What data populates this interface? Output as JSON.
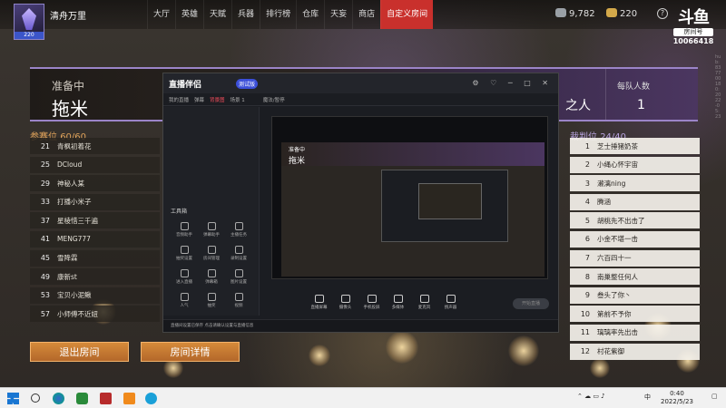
{
  "player": {
    "name": "清舟万里",
    "level": "220"
  },
  "nav": [
    "大厅",
    "英雄",
    "天赋",
    "兵器",
    "排行榜",
    "仓库",
    "天妄",
    "商店",
    "自定义房间"
  ],
  "nav_active_index": 8,
  "currency": {
    "gold_coins": "9,782",
    "gold_bars": "220",
    "coin_color": "#9aa0a6",
    "bar_color": "#d4a94a"
  },
  "watermark": {
    "brand": "斗鱼",
    "room_label": "房间号",
    "room_number": "10066418",
    "side_text": "hub:83770018 0:2022-05:23"
  },
  "room": {
    "status": "准备中",
    "name": "拖米",
    "mode_partial": "之人",
    "team_size_label": "每队人数",
    "team_size": "1"
  },
  "participants": {
    "title": "参赛位",
    "count": "60/60",
    "items": [
      {
        "num": "21",
        "name": "青枫初着花"
      },
      {
        "num": "25",
        "name": "DCloud"
      },
      {
        "num": "29",
        "name": "神秘人某"
      },
      {
        "num": "33",
        "name": "打播小米子"
      },
      {
        "num": "37",
        "name": "星棱惜三千遍"
      },
      {
        "num": "41",
        "name": "MENG777"
      },
      {
        "num": "45",
        "name": "雪降霖"
      },
      {
        "num": "49",
        "name": "康新st"
      },
      {
        "num": "53",
        "name": "宝贝小泥鳅"
      },
      {
        "num": "57",
        "name": "小师傅不近妞"
      }
    ]
  },
  "referees": {
    "title": "裁判位",
    "count": "24/40",
    "items": [
      {
        "num": "1",
        "name": "芝士捶猪奶茶"
      },
      {
        "num": "2",
        "name": "小绳心怀宇宙"
      },
      {
        "num": "3",
        "name": "濑漓ning"
      },
      {
        "num": "4",
        "name": "腾涵"
      },
      {
        "num": "5",
        "name": "胡桃先不出击了"
      },
      {
        "num": "6",
        "name": "小金不堪一击"
      },
      {
        "num": "7",
        "name": "六百四十一"
      },
      {
        "num": "8",
        "name": "南巢整任何人"
      },
      {
        "num": "9",
        "name": "叁头了你丶"
      },
      {
        "num": "10",
        "name": "第前不予你"
      },
      {
        "num": "11",
        "name": "璃璃率先出击"
      },
      {
        "num": "12",
        "name": "村花紫御"
      }
    ]
  },
  "buttons": {
    "leave_room": "退出房间",
    "room_details": "房间详情"
  },
  "stream_app": {
    "title": "直播伴侣",
    "badge": "测试版",
    "tabs": [
      "我的直播",
      "弹幕",
      "背景图",
      "场景 1"
    ],
    "live_tab": "魔法/暂停",
    "sidebar_tool_title": "工具箱",
    "tools": [
      "音频助手",
      "弹幕助手",
      "主播任务",
      "抽奖设置",
      "房间管理",
      "录制设置",
      "进入直播",
      "弹幕箱",
      "图片设置",
      "人气",
      "抽奖",
      "视频"
    ],
    "preview_status": "准备中",
    "preview_name": "拖米",
    "controls": [
      "直播屏幕",
      "摄像头",
      "手机投屏",
      "多媒体",
      "麦克风",
      "扬声器"
    ],
    "start_label": "开始直播",
    "status_text": "直播间设置已保存 点击请确认设置与直播信息"
  },
  "taskbar": {
    "time": "0:40",
    "date": "2022/5/23",
    "lang": "中"
  }
}
